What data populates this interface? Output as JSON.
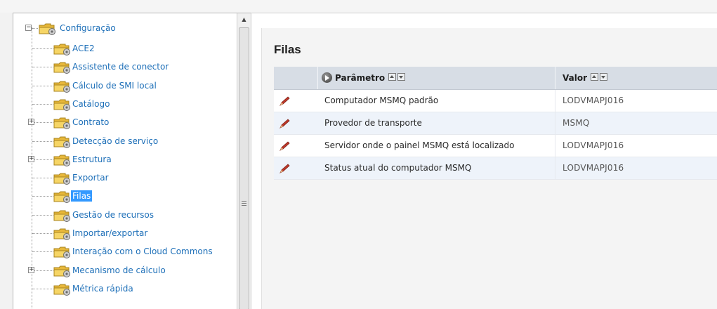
{
  "tree": {
    "root_label": "Configuração",
    "items": [
      {
        "label": "ACE2",
        "expandable": false,
        "selected": false
      },
      {
        "label": "Assistente de conector",
        "expandable": false,
        "selected": false
      },
      {
        "label": "Cálculo de SMI local",
        "expandable": false,
        "selected": false
      },
      {
        "label": "Catálogo",
        "expandable": false,
        "selected": false
      },
      {
        "label": "Contrato",
        "expandable": true,
        "selected": false
      },
      {
        "label": "Detecção de serviço",
        "expandable": false,
        "selected": false
      },
      {
        "label": "Estrutura",
        "expandable": true,
        "selected": false
      },
      {
        "label": "Exportar",
        "expandable": false,
        "selected": false
      },
      {
        "label": "Filas",
        "expandable": false,
        "selected": true
      },
      {
        "label": "Gestão de recursos",
        "expandable": false,
        "selected": false
      },
      {
        "label": "Importar/exportar",
        "expandable": false,
        "selected": false
      },
      {
        "label": "Interação com o Cloud Commons",
        "expandable": false,
        "selected": false
      },
      {
        "label": "Mecanismo de cálculo",
        "expandable": true,
        "selected": false
      },
      {
        "label": "Métrica rápida",
        "expandable": false,
        "selected": false
      }
    ]
  },
  "content": {
    "title": "Filas",
    "columns": {
      "parameter": "Parâmetro",
      "value": "Valor"
    },
    "rows": [
      {
        "parameter": "Computador MSMQ padrão",
        "value": "LODVMAPJ016"
      },
      {
        "parameter": "Provedor de transporte",
        "value": "MSMQ"
      },
      {
        "parameter": "Servidor onde o painel MSMQ está localizado",
        "value": "LODVMAPJ016"
      },
      {
        "parameter": "Status atual do computador MSMQ",
        "value": "LODVMAPJ016"
      }
    ]
  },
  "colors": {
    "link": "#1d6fb8",
    "selection": "#3399ff",
    "header_bg": "#d7dde5",
    "alt_row": "#eef3fa",
    "pencil": "#c0392b"
  }
}
